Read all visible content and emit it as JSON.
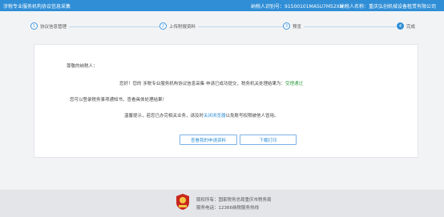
{
  "header": {
    "title": "涉税专业服务机构协议信息采集",
    "taxpayer_id": "纳税人识别号：91500101MA5U7M52XN",
    "taxpayer_name": "纳税人名称：重庆弘创机械设备租赁有限公司"
  },
  "steps": [
    {
      "num": "①",
      "label": "协议信息管理"
    },
    {
      "num": "②",
      "label": "上传附报资料"
    },
    {
      "num": "③",
      "label": "预览"
    },
    {
      "num": "4",
      "label": "完成"
    }
  ],
  "card": {
    "greeting": "尊敬的纳税人：",
    "line2_prefix": "您好！您的 涉税专业服务机构协议信息采集 申请已成功提交，税务机关处理结果为：",
    "line2_status": "受理通过",
    "line3": "您可以登录税务事项通知书，查看具体处理结果！",
    "line4_prefix": "温馨提示，若您已办完相关业务，请及时",
    "line4_link": "关闭浏览器",
    "line4_suffix": "以免账号权限被他人冒用。",
    "btn_view": "查看我的申请资料",
    "btn_download": "下载打印"
  },
  "footer": {
    "copyright": "版权所有：国家税务总局重庆市税务局",
    "hotline": "服务电话：12366纳税服务热线"
  },
  "colors": {
    "header_bg": "#2f8ed6",
    "status_green": "#3aa24a",
    "link_blue": "#2f8ed6",
    "emblem_red": "#c8261d"
  },
  "icons": {
    "footer_logo": "tax-emblem-icon"
  }
}
